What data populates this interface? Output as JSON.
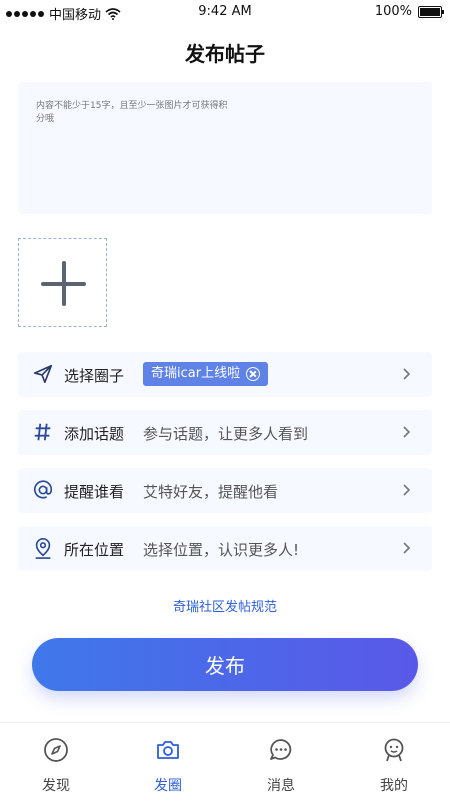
{
  "status_bar": {
    "carrier": "中国移动",
    "time": "9:42 AM",
    "battery": "100%"
  },
  "header": {
    "title": "发布帖子"
  },
  "content_input": {
    "placeholder": "内容不能少于15字，且至少一张图片才可获得积分哦"
  },
  "options": [
    {
      "label": "选择圈子",
      "tag": "奇瑞icar上线啦",
      "icon": "send-icon"
    },
    {
      "label": "添加话题",
      "value": "参与话题，让更多人看到",
      "icon": "hashtag-icon"
    },
    {
      "label": "提醒谁看",
      "value": "艾特好友，提醒他看",
      "icon": "at-icon"
    },
    {
      "label": "所在位置",
      "value": "选择位置，认识更多人!",
      "icon": "location-pin-icon"
    }
  ],
  "rules_link": "奇瑞社区发帖规范",
  "publish_button": "发布",
  "tabbar": {
    "active_color": "#2e5fd6",
    "items": [
      {
        "label": "发现",
        "icon": "compass-icon"
      },
      {
        "label": "发圈",
        "icon": "camera-icon"
      },
      {
        "label": "消息",
        "icon": "chat-bubble-icon"
      },
      {
        "label": "我的",
        "icon": "profile-icon"
      }
    ]
  }
}
